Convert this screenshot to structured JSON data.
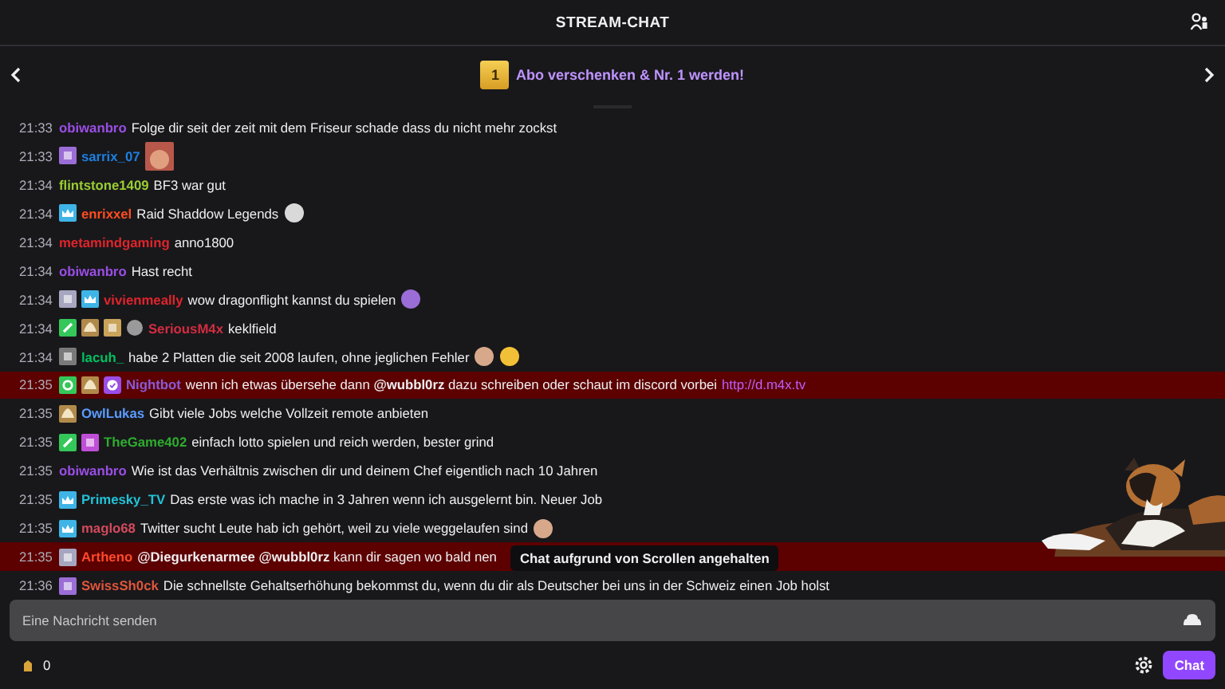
{
  "header": {
    "title": "STREAM-CHAT"
  },
  "banner": {
    "gift_number": "1",
    "text": "Abo verschenken & Nr. 1 werden!"
  },
  "messages": [
    {
      "time": "21:33",
      "user": "obiwanbro",
      "color": "#9b4ee6",
      "text": "Folge dir seit der zeit mit dem Friseur schade dass du nicht mehr zockst",
      "highlighted": false
    },
    {
      "time": "21:33",
      "badges": [
        {
          "kind": "box",
          "color": "#9b6dd6"
        }
      ],
      "user": "sarrix_07",
      "color": "#1e7fe0",
      "highlighted": false,
      "emotes": [
        {
          "kind": "big",
          "color": "#b8584a"
        }
      ]
    },
    {
      "time": "21:34",
      "user": "flintstone1409",
      "color": "#9acd32",
      "text": "BF3 war gut",
      "highlighted": false
    },
    {
      "time": "21:34",
      "badges": [
        {
          "kind": "crown",
          "color": "#3fb4e6"
        }
      ],
      "user": "enrixxel",
      "color": "#ff4d1f",
      "text": "Raid Shaddow Legends",
      "highlighted": false,
      "emotes": [
        {
          "kind": "face",
          "color": "#d9d9d9"
        }
      ]
    },
    {
      "time": "21:34",
      "user": "metamindgaming",
      "color": "#e0242c",
      "text": "anno1800",
      "highlighted": false
    },
    {
      "time": "21:34",
      "user": "obiwanbro",
      "color": "#9b4ee6",
      "text": "Hast recht",
      "highlighted": false
    },
    {
      "time": "21:34",
      "badges": [
        {
          "kind": "box",
          "color": "#a6a6c0"
        },
        {
          "kind": "crown",
          "color": "#3fb4e6"
        }
      ],
      "user": "vivienmeally",
      "color": "#e0242c",
      "text": "wow dragonflight kannst du spielen",
      "highlighted": false,
      "emotes": [
        {
          "kind": "face",
          "color": "#9b6dd6"
        }
      ]
    },
    {
      "time": "21:34",
      "badges": [
        {
          "kind": "sword",
          "color": "#34c759"
        },
        {
          "kind": "leaf",
          "color": "#b08a4a"
        },
        {
          "kind": "box",
          "color": "#c9a45a"
        },
        {
          "kind": "face",
          "color": "#9a9a9a"
        }
      ],
      "user": "SeriousM4x",
      "color": "#d22d40",
      "text": "keklfield",
      "highlighted": false
    },
    {
      "time": "21:34",
      "badges": [
        {
          "kind": "box",
          "color": "#7a7a7a"
        }
      ],
      "user": "lacuh_",
      "color": "#00c060",
      "text": "habe 2 Platten die seit 2008 laufen, ohne jeglichen Fehler",
      "highlighted": false,
      "emotes": [
        {
          "kind": "face",
          "color": "#d8a88a"
        },
        {
          "kind": "face",
          "color": "#f2c037"
        }
      ]
    },
    {
      "time": "21:35",
      "badges": [
        {
          "kind": "gear",
          "color": "#34c759"
        },
        {
          "kind": "leaf",
          "color": "#b08a4a"
        },
        {
          "kind": "check",
          "color": "#9b4ee6"
        }
      ],
      "user": "Nightbot",
      "color": "#8a5ad6",
      "text": "wenn ich etwas übersehe dann **@wubbl0rz** dazu schreiben oder schaut im discord vorbei",
      "link": "http://d.m4x.tv",
      "highlighted": true
    },
    {
      "time": "21:35",
      "badges": [
        {
          "kind": "leaf",
          "color": "#b08a4a"
        }
      ],
      "user": "OwlLukas",
      "color": "#5b9bff",
      "text": "Gibt viele Jobs welche Vollzeit remote anbieten",
      "highlighted": false
    },
    {
      "time": "21:35",
      "badges": [
        {
          "kind": "sword",
          "color": "#34c759"
        },
        {
          "kind": "box",
          "color": "#c04fd8"
        }
      ],
      "user": "TheGame402",
      "color": "#2eac2e",
      "text": "einfach lotto spielen und reich werden, bester grind",
      "highlighted": false
    },
    {
      "time": "21:35",
      "user": "obiwanbro",
      "color": "#9b4ee6",
      "text": "Wie ist das Verhältnis zwischen dir und deinem Chef eigentlich nach 10 Jahren",
      "highlighted": false
    },
    {
      "time": "21:35",
      "badges": [
        {
          "kind": "crown",
          "color": "#3fb4e6"
        }
      ],
      "user": "Primesky_TV",
      "color": "#23c2d6",
      "text": "Das erste was ich mache in 3 Jahren wenn ich ausgelernt bin. Neuer Job",
      "highlighted": false
    },
    {
      "time": "21:35",
      "badges": [
        {
          "kind": "crown",
          "color": "#3fb4e6"
        }
      ],
      "user": "maglo68",
      "color": "#d44a5c",
      "text": "Twitter sucht Leute hab ich gehört, weil zu viele weggelaufen sind",
      "highlighted": false,
      "emotes": [
        {
          "kind": "face",
          "color": "#d8a88a"
        }
      ]
    },
    {
      "time": "21:35",
      "badges": [
        {
          "kind": "box",
          "color": "#a6a6c0"
        }
      ],
      "user": "Artheno",
      "color": "#ff4a2a",
      "text": "**@Diegurkenarmee @wubbl0rz** kann dir sagen wo bald nen",
      "highlighted": true
    },
    {
      "time": "21:36",
      "badges": [
        {
          "kind": "box",
          "color": "#9b6dd6"
        }
      ],
      "user": "SwissSh0ck",
      "color": "#e0553a",
      "text": "Die schnellste Gehaltserhöhung bekommst du, wenn du dir als Deutscher bei uns in der Schweiz einen Job holst",
      "highlighted": false
    }
  ],
  "paused_notice": "Chat aufgrund von Scrollen angehalten",
  "input": {
    "placeholder": "Eine Nachricht senden"
  },
  "footer": {
    "points": "0",
    "send_button": "Chat"
  }
}
